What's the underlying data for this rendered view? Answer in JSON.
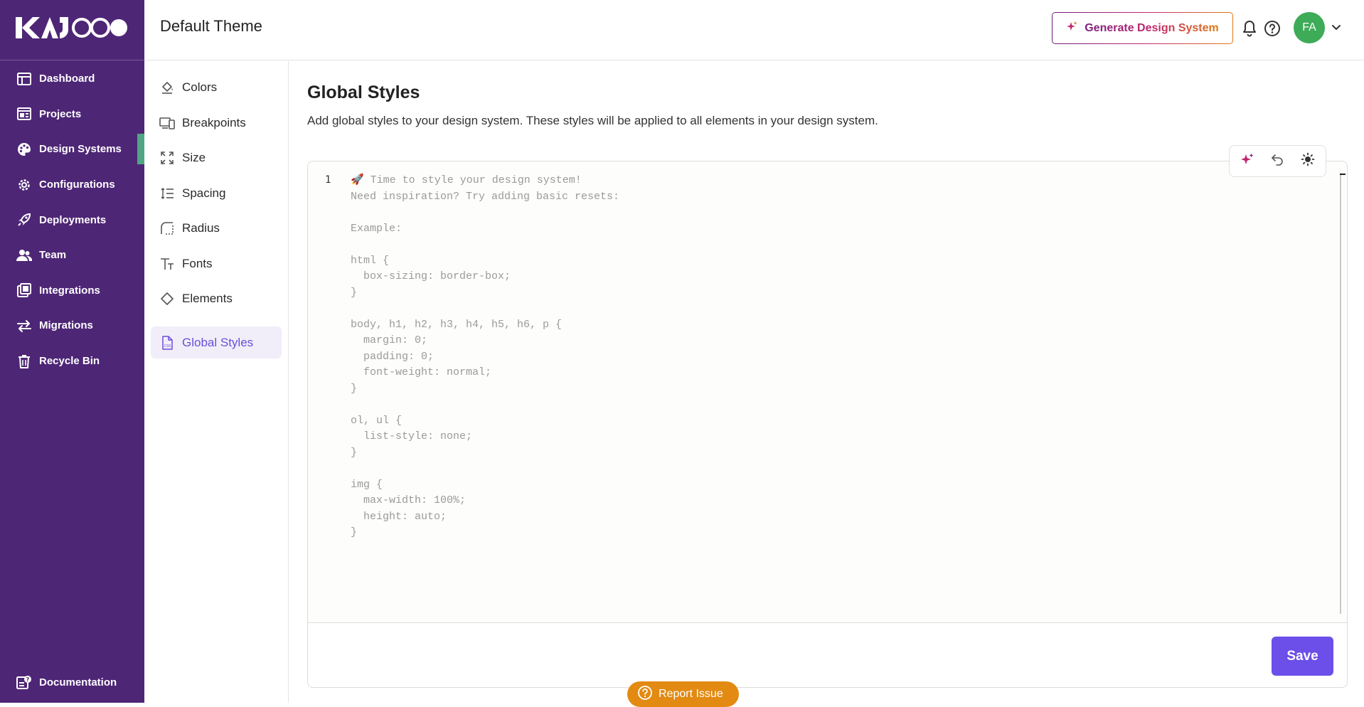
{
  "app": {
    "logo_text": "KAJOO"
  },
  "nav": {
    "items": [
      {
        "label": "Dashboard",
        "icon": "dashboard-icon"
      },
      {
        "label": "Projects",
        "icon": "projects-icon"
      },
      {
        "label": "Design Systems",
        "icon": "palette-icon",
        "active": true
      },
      {
        "label": "Configurations",
        "icon": "gear-icon"
      },
      {
        "label": "Deployments",
        "icon": "rocket-icon"
      },
      {
        "label": "Team",
        "icon": "team-icon"
      },
      {
        "label": "Integrations",
        "icon": "integrations-icon"
      },
      {
        "label": "Migrations",
        "icon": "migrations-icon"
      },
      {
        "label": "Recycle Bin",
        "icon": "trash-icon"
      }
    ],
    "documentation_label": "Documentation"
  },
  "header": {
    "title": "Default Theme",
    "generate_label": "Generate Design System",
    "avatar_initials": "FA"
  },
  "subnav": {
    "items": [
      {
        "label": "Colors",
        "icon": "paint-bucket-icon"
      },
      {
        "label": "Breakpoints",
        "icon": "devices-icon"
      },
      {
        "label": "Size",
        "icon": "expand-icon"
      },
      {
        "label": "Spacing",
        "icon": "line-spacing-icon"
      },
      {
        "label": "Radius",
        "icon": "radius-icon"
      },
      {
        "label": "Fonts",
        "icon": "text-size-icon"
      },
      {
        "label": "Elements",
        "icon": "diamond-icon"
      },
      {
        "label": "Global Styles",
        "icon": "css-file-icon",
        "active": true
      }
    ]
  },
  "main": {
    "title": "Global Styles",
    "description": "Add global styles to your design system. These styles will be applied to all elements in your design system.",
    "editor": {
      "line_number": "1",
      "placeholder": "🚀 Time to style your design system!\nNeed inspiration? Try adding basic resets:\n\nExample:\n\nhtml {\n  box-sizing: border-box;\n}\n\nbody, h1, h2, h3, h4, h5, h6, p {\n  margin: 0;\n  padding: 0;\n  font-weight: normal;\n}\n\nol, ul {\n  list-style: none;\n}\n\nimg {\n  max-width: 100%;\n  height: auto;\n}"
    },
    "save_label": "Save"
  },
  "report_label": "Report Issue",
  "colors": {
    "nav_bg": "#4e2676",
    "accent": "#6b4fe8",
    "active_marker": "#4fa585",
    "report_bg": "#e28a12",
    "avatar_bg": "#3dab57"
  }
}
